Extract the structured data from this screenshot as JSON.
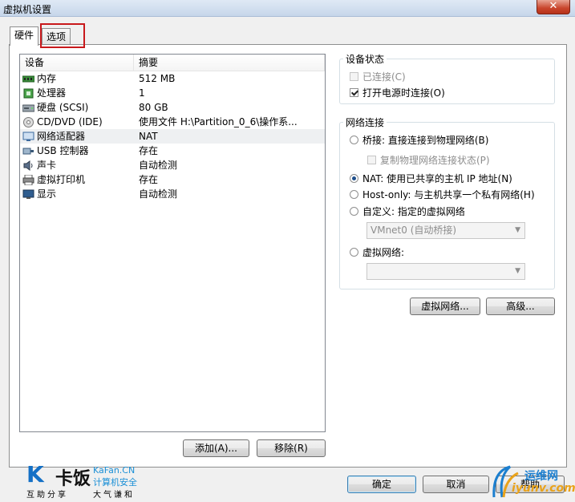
{
  "window": {
    "title": "虚拟机设置",
    "close_glyph": "✕"
  },
  "tabs": [
    {
      "label": "硬件",
      "active": true
    },
    {
      "label": "选项",
      "active": false
    }
  ],
  "device_list": {
    "columns": [
      "设备",
      "摘要"
    ],
    "rows": [
      {
        "device": "内存",
        "summary": "512 MB",
        "icon": "memory-icon"
      },
      {
        "device": "处理器",
        "summary": "1",
        "icon": "processor-icon"
      },
      {
        "device": "硬盘 (SCSI)",
        "summary": "80 GB",
        "icon": "hard-disk-icon"
      },
      {
        "device": "CD/DVD (IDE)",
        "summary": "使用文件 H:\\Partition_0_6\\操作系...",
        "icon": "cd-dvd-icon"
      },
      {
        "device": "网络适配器",
        "summary": "NAT",
        "icon": "network-adapter-icon",
        "selected": true
      },
      {
        "device": "USB 控制器",
        "summary": "存在",
        "icon": "usb-icon"
      },
      {
        "device": "声卡",
        "summary": "自动检测",
        "icon": "sound-card-icon"
      },
      {
        "device": "虚拟打印机",
        "summary": "存在",
        "icon": "printer-icon"
      },
      {
        "device": "显示",
        "summary": "自动检测",
        "icon": "display-icon"
      }
    ],
    "add_button": "添加(A)...",
    "remove_button": "移除(R)"
  },
  "device_status": {
    "title": "设备状态",
    "connected": {
      "label": "已连接(C)",
      "checked": false,
      "enabled": false
    },
    "connect_at_power_on": {
      "label": "打开电源时连接(O)",
      "checked": true,
      "enabled": true
    }
  },
  "network_connection": {
    "title": "网络连接",
    "bridged": {
      "label": "桥接: 直接连接到物理网络(B)",
      "selected": false
    },
    "replicate": {
      "label": "复制物理网络连接状态(P)",
      "checked": false,
      "enabled": false
    },
    "nat": {
      "label": "NAT: 使用已共享的主机 IP 地址(N)",
      "selected": true
    },
    "host_only": {
      "label": "Host-only: 与主机共享一个私有网络(H)",
      "selected": false
    },
    "custom": {
      "label": "自定义: 指定的虚拟网络",
      "selected": false
    },
    "custom_select_value": "VMnet0 (自动桥接)",
    "virtual_network": {
      "label": "虚拟网络:",
      "selected": false
    },
    "virtual_network_select_value": "",
    "virtual_network_button": "虚拟网络...",
    "advanced_button": "高级..."
  },
  "footer": {
    "ok_button": "确定",
    "cancel_button": "取消",
    "help_button": "帮助"
  },
  "watermark": {
    "brand_letter": "K",
    "brand_name": "卡饭",
    "tagline_left": "互助分享",
    "site": "KaFan.CN",
    "subtitle": "计算机安全",
    "tagline_right": "大气谦和",
    "corner_text": "运维网",
    "corner_url": "iyunv.com"
  },
  "colors": {
    "accent": "#1f4f8b",
    "highlight_box": "#c8191c",
    "brand_blue": "#1470c6"
  }
}
